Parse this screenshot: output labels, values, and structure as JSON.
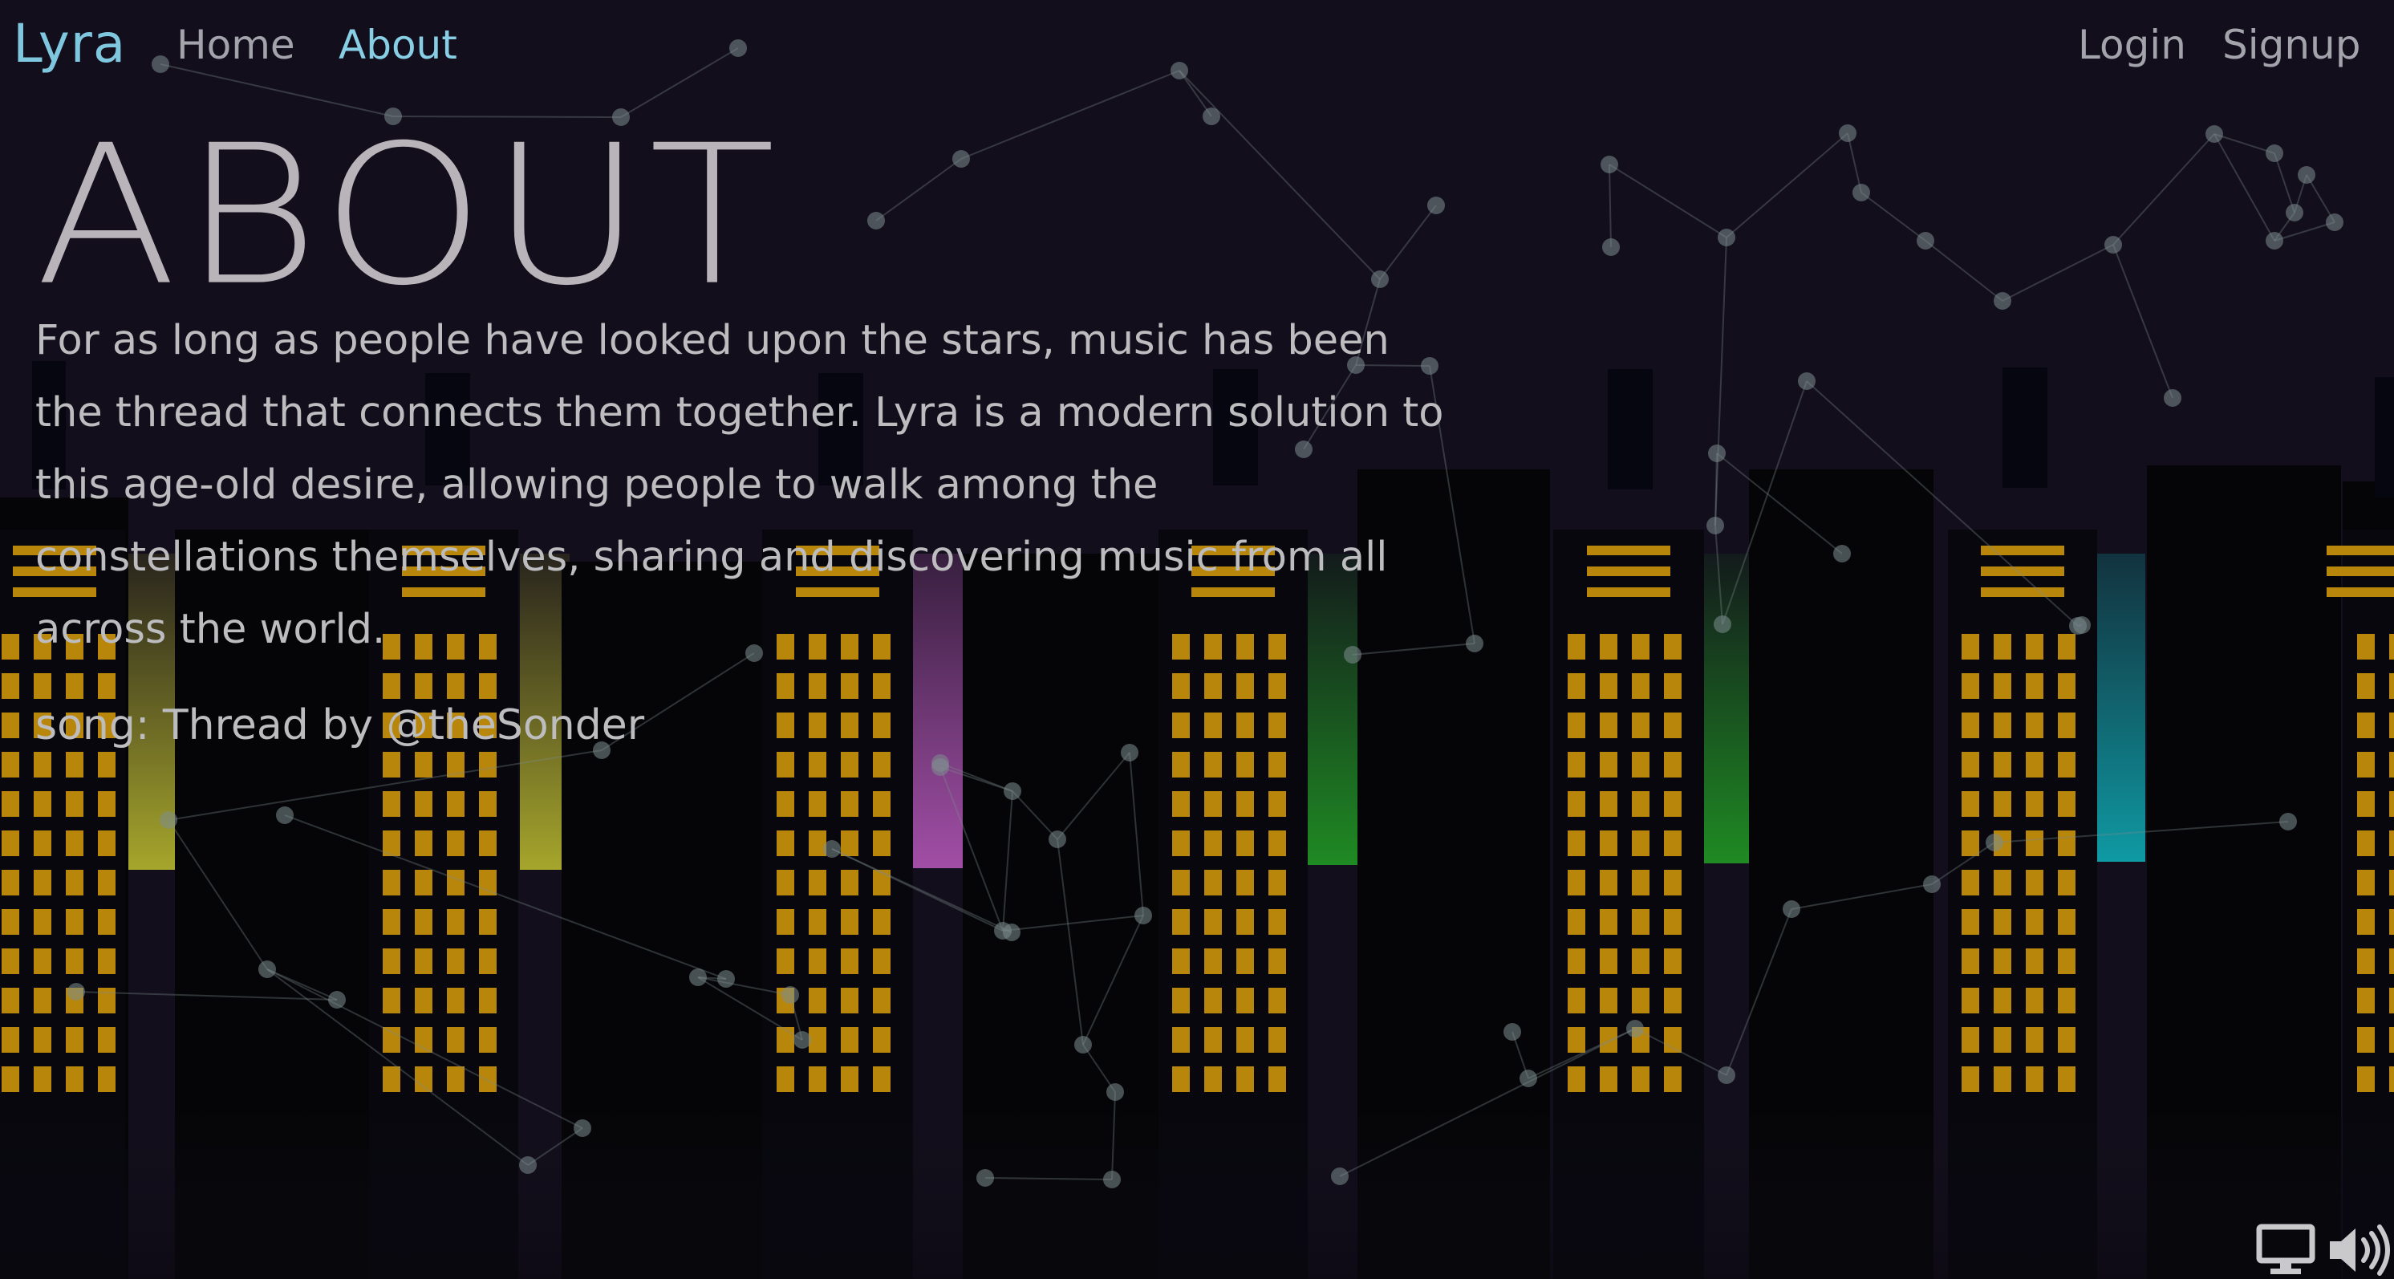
{
  "nav": {
    "brand": "Lyra",
    "links": {
      "home": "Home",
      "about": "About",
      "login": "Login",
      "signup": "Signup"
    }
  },
  "main": {
    "title": "ABOUT",
    "body": "For as long as people have looked upon the stars, music has been the thread that connects them together. Lyra is a modern solution to this age-old desire, allowing people to walk among the constellations themselves, sharing and discovering music from all across the world.",
    "song_credit": "song: Thread by @theSonder"
  },
  "controls": {
    "screen_icon": "monitor-icon",
    "volume_icon": "volume-icon"
  },
  "colors": {
    "background": "#120e1b",
    "brand": "#7fc7de",
    "window_light": "#b8860b",
    "glow_yellow": "#a3a02a",
    "glow_purple": "#a551a8",
    "glow_green": "#1f8a23",
    "glow_teal": "#118a92"
  }
}
